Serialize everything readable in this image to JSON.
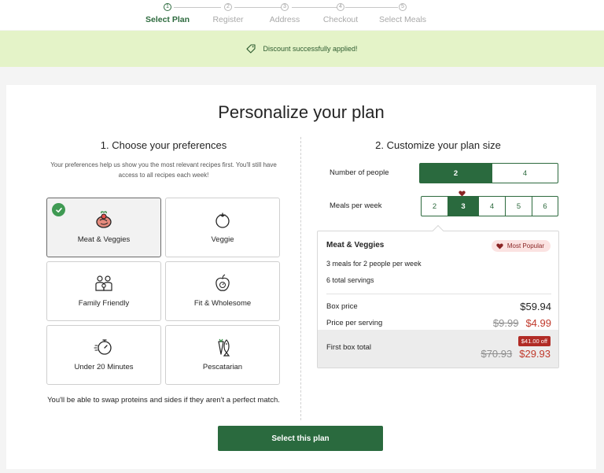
{
  "stepper": {
    "steps": [
      {
        "num": "1",
        "label": "Select Plan"
      },
      {
        "num": "2",
        "label": "Register"
      },
      {
        "num": "3",
        "label": "Address"
      },
      {
        "num": "4",
        "label": "Checkout"
      },
      {
        "num": "5",
        "label": "Select Meals"
      }
    ],
    "active_step": 1
  },
  "banner": {
    "text": "Discount successfully applied!",
    "icon": "tag-icon"
  },
  "page": {
    "title": "Personalize your plan"
  },
  "preferences": {
    "title": "1. Choose your preferences",
    "description": "Your preferences help us show you the most relevant recipes first. You'll still have access to all recipes each week!",
    "tiles": [
      {
        "label": "Meat & Veggies",
        "icon": "steak-veggies-icon",
        "selected": true
      },
      {
        "label": "Veggie",
        "icon": "tomato-icon",
        "selected": false
      },
      {
        "label": "Family Friendly",
        "icon": "family-icon",
        "selected": false
      },
      {
        "label": "Fit & Wholesome",
        "icon": "apple-scale-icon",
        "selected": false
      },
      {
        "label": "Under 20 Minutes",
        "icon": "stopwatch-icon",
        "selected": false
      },
      {
        "label": "Pescatarian",
        "icon": "fish-carrot-icon",
        "selected": false
      }
    ],
    "swap_note": "You'll be able to swap proteins and sides if they aren't a perfect match."
  },
  "plan_size": {
    "title": "2. Customize your plan size",
    "people_label": "Number of people",
    "people_options": [
      "2",
      "4"
    ],
    "people_selected": "2",
    "meals_label": "Meals per week",
    "meals_options": [
      "2",
      "3",
      "4",
      "5",
      "6"
    ],
    "meals_selected": "3"
  },
  "summary": {
    "title": "Meat & Veggies",
    "badge": "Most Popular",
    "line1": "3 meals for 2 people per week",
    "line2": "6 total servings",
    "box_price_label": "Box price",
    "box_price": "$59.94",
    "per_serving_label": "Price per serving",
    "per_serving_old": "$9.99",
    "per_serving_new": "$4.99",
    "first_box_label": "First box total",
    "discount_badge": "$41.00 off",
    "first_box_old": "$70.93",
    "first_box_new": "$29.93"
  },
  "cta": {
    "label": "Select this plan"
  },
  "colors": {
    "brand": "#2a6a3e",
    "banner": "#e4f3c8",
    "sale": "#c0392b"
  }
}
